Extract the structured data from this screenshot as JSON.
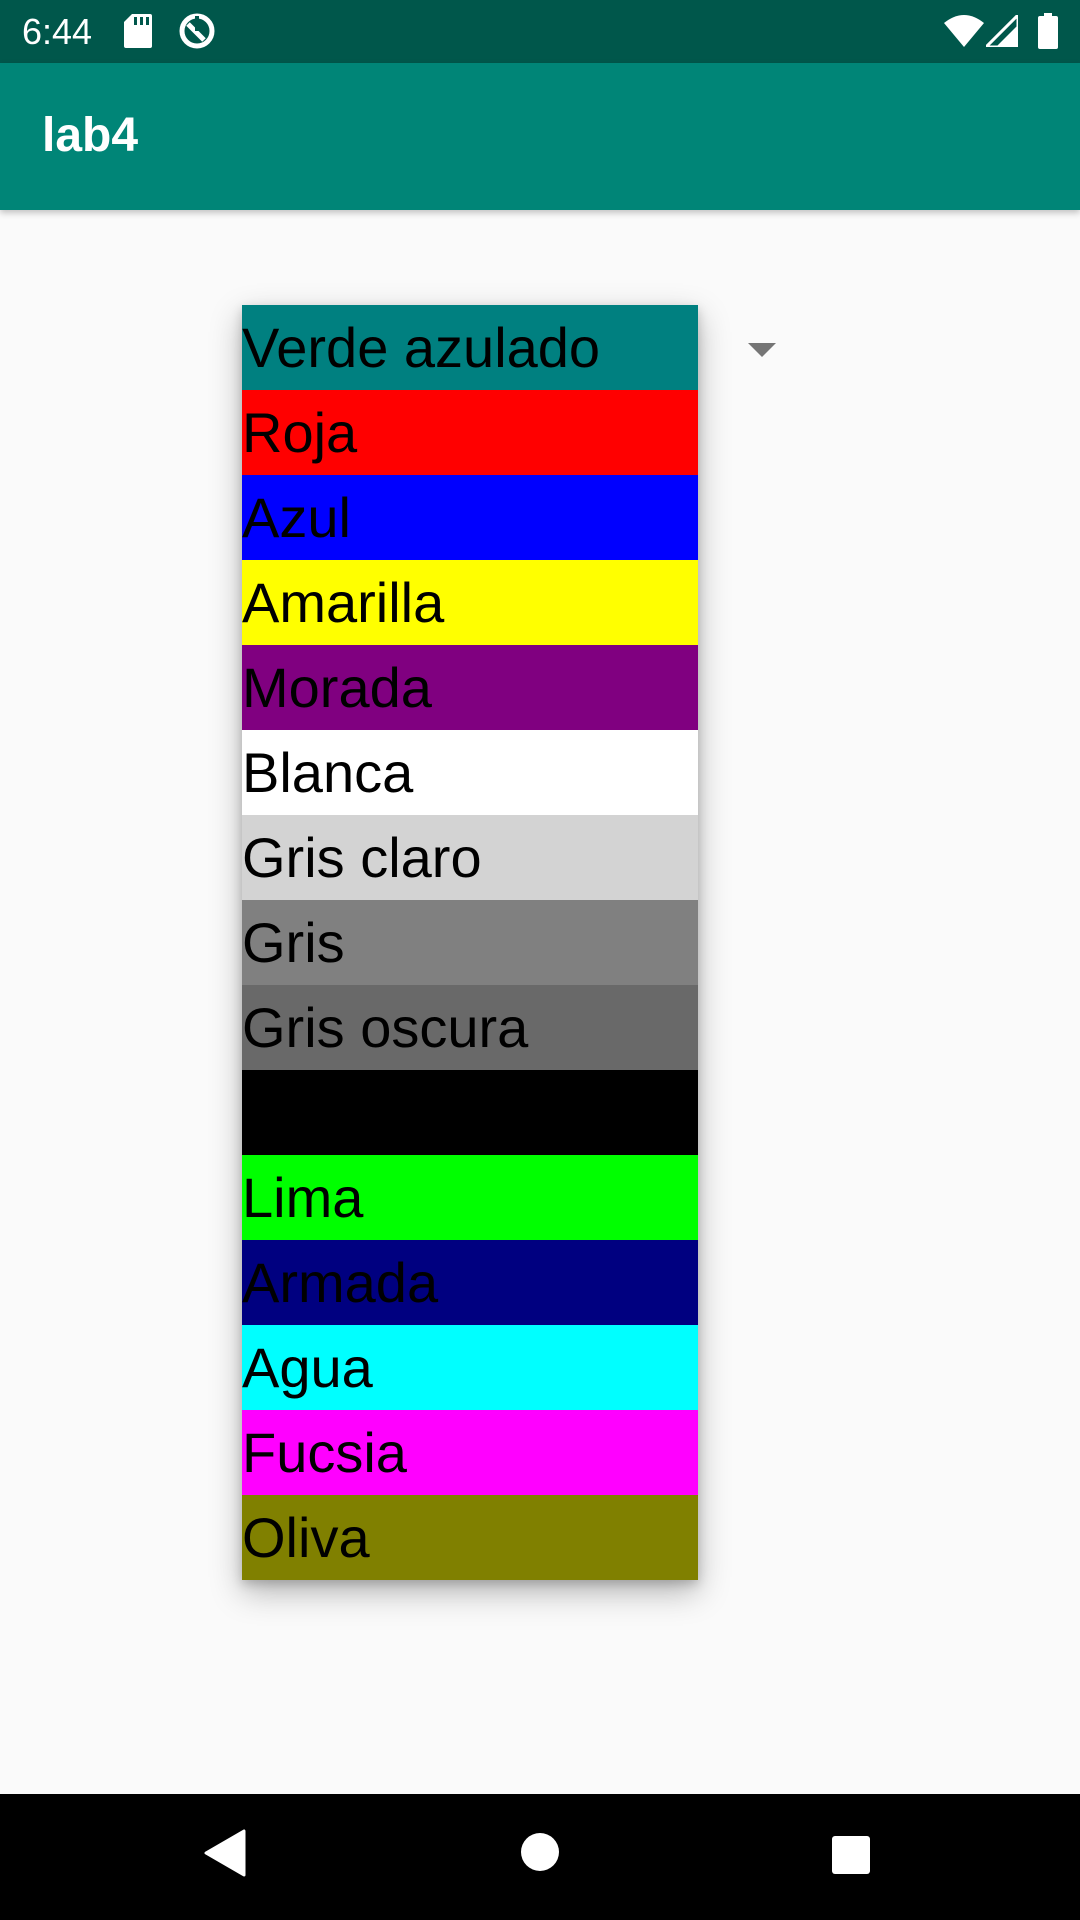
{
  "status_bar": {
    "time": "6:44",
    "icons": [
      "sd-card-icon",
      "sync-icon",
      "wifi-icon",
      "signal-icon",
      "battery-icon"
    ]
  },
  "app_bar": {
    "title": "lab4",
    "color": "#008577"
  },
  "spinner": {
    "selected": "Verde azulado",
    "arrow_icon": "dropdown-arrow-icon"
  },
  "dropdown": {
    "items": [
      {
        "label": "Verde azulado",
        "color": "#008080"
      },
      {
        "label": "Roja",
        "color": "#ff0000"
      },
      {
        "label": "Azul",
        "color": "#0000ff"
      },
      {
        "label": "Amarilla",
        "color": "#ffff00"
      },
      {
        "label": "Morada",
        "color": "#800080"
      },
      {
        "label": "Blanca",
        "color": "#ffffff"
      },
      {
        "label": "Gris claro",
        "color": "#d3d3d3"
      },
      {
        "label": "Gris",
        "color": "#808080"
      },
      {
        "label": "Gris oscura",
        "color": "#696969"
      },
      {
        "label": "",
        "color": "#000000"
      },
      {
        "label": "Lima",
        "color": "#00ff00"
      },
      {
        "label": "Armada",
        "color": "#000080"
      },
      {
        "label": "Agua",
        "color": "#00ffff"
      },
      {
        "label": "Fucsia",
        "color": "#ff00ff"
      },
      {
        "label": "Oliva",
        "color": "#808000"
      }
    ]
  },
  "nav_bar": {
    "icons": [
      "back-icon",
      "home-icon",
      "recents-icon"
    ]
  }
}
